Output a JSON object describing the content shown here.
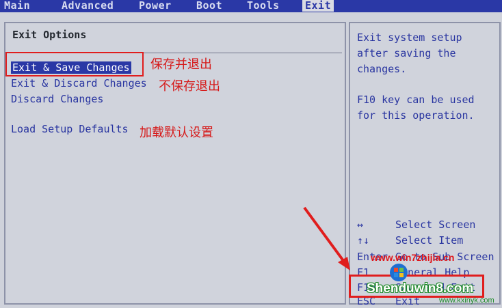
{
  "menu": {
    "tabs": [
      {
        "label": "Main"
      },
      {
        "label": "Advanced"
      },
      {
        "label": "Power"
      },
      {
        "label": "Boot"
      },
      {
        "label": "Tools"
      },
      {
        "label": "Exit"
      }
    ],
    "active_tab": "Exit"
  },
  "main": {
    "title": "Exit Options",
    "options": [
      {
        "label": "Exit & Save Changes",
        "annotation": "保存并退出",
        "selected": true
      },
      {
        "label": "Exit & Discard Changes",
        "annotation": "不保存退出"
      },
      {
        "label": "Discard Changes",
        "annotation": ""
      },
      {
        "label": "Load Setup Defaults",
        "annotation": "加载默认设置"
      }
    ]
  },
  "help": {
    "lines": [
      "Exit system setup",
      "after saving the",
      "changes.",
      "",
      "F10 key can be used",
      "for this operation."
    ],
    "keys": [
      {
        "key": "↔",
        "desc": "Select Screen"
      },
      {
        "key": "↑↓",
        "desc": "Select Item"
      },
      {
        "key": "Enter",
        "desc": "Go to Sub Screen"
      },
      {
        "key": "F1",
        "desc": "General Help"
      },
      {
        "key": "F10",
        "desc": "Save and Exit"
      },
      {
        "key": "ESC",
        "desc": "Exit"
      }
    ]
  },
  "watermark": {
    "url": "www.win7zhijia.cn",
    "name": "Shenduwin8.com",
    "site": "www.kxinyk.com"
  },
  "colors": {
    "menubar": "#2a38a6",
    "text_blue": "#2834a0",
    "annotation_red": "#d61a1a"
  }
}
